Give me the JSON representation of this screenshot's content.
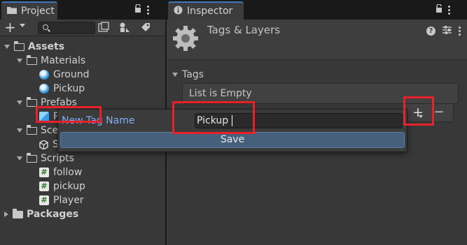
{
  "project_panel": {
    "tab_label": "Project",
    "tree": [
      {
        "label": "Assets",
        "kind": "folder-open",
        "depth": 0,
        "bold": true
      },
      {
        "label": "Materials",
        "kind": "folder-open",
        "depth": 1
      },
      {
        "label": "Ground",
        "kind": "material",
        "depth": 2
      },
      {
        "label": "Pickup",
        "kind": "material",
        "depth": 2
      },
      {
        "label": "Prefabs",
        "kind": "folder-open",
        "depth": 1
      },
      {
        "label": "P",
        "kind": "prefab",
        "depth": 2
      },
      {
        "label": "Sce",
        "kind": "folder-open",
        "depth": 1
      },
      {
        "label": "S",
        "kind": "scene",
        "depth": 2
      },
      {
        "label": "Scripts",
        "kind": "folder-open",
        "depth": 1
      },
      {
        "label": "follow",
        "kind": "script",
        "depth": 2
      },
      {
        "label": "pickup",
        "kind": "script",
        "depth": 2
      },
      {
        "label": "Player",
        "kind": "script",
        "depth": 2
      },
      {
        "label": "Packages",
        "kind": "folder",
        "depth": 0,
        "bold": true
      }
    ]
  },
  "inspector": {
    "tab_label": "Inspector",
    "title": "Tags & Layers",
    "section_label": "Tags",
    "list_empty_text": "List is Empty",
    "add_label": "+",
    "remove_label": "−"
  },
  "popup": {
    "label": "New Tag Name",
    "input_value": "Pickup",
    "save_label": "Save"
  },
  "colors": {
    "highlight": "#e8202a",
    "accent": "#3a79bb",
    "save_button": "#46607c"
  }
}
